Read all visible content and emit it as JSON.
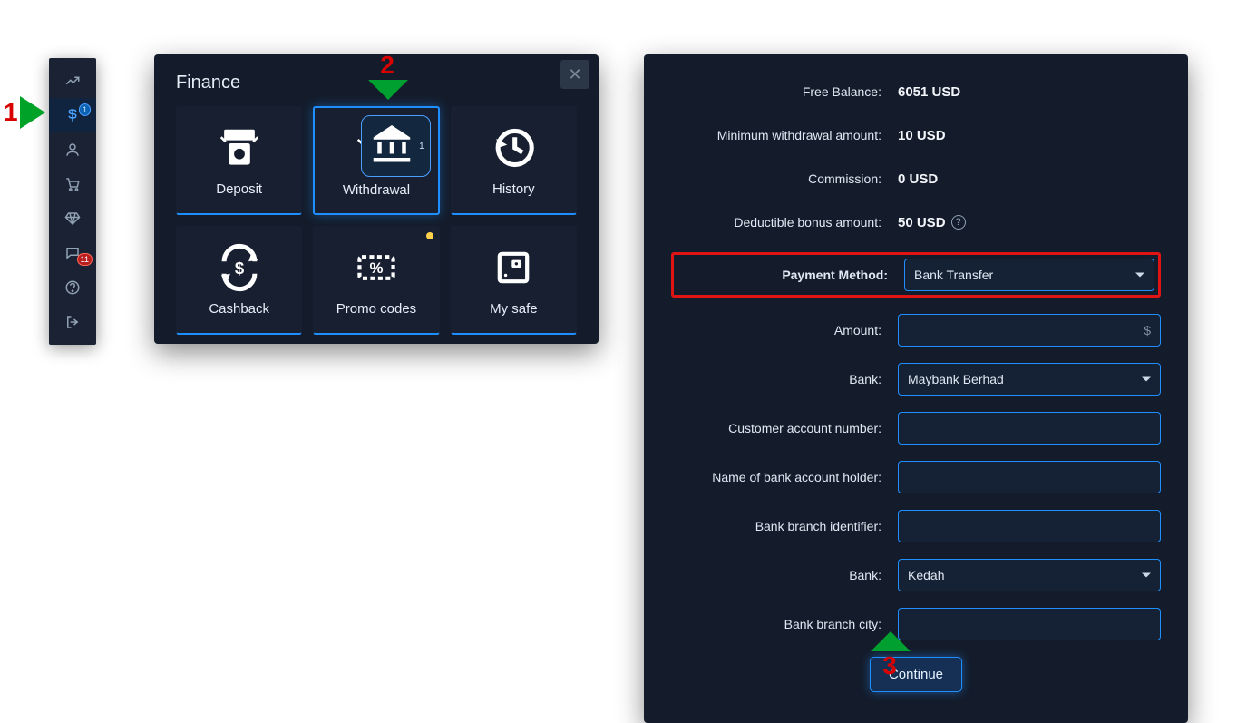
{
  "markers": {
    "one": "1",
    "two": "2",
    "three": "3"
  },
  "sidebar": {
    "items": [
      {
        "name": "chart-icon"
      },
      {
        "name": "finance-icon",
        "badge": "1",
        "active": true
      },
      {
        "name": "profile-icon"
      },
      {
        "name": "cart-icon"
      },
      {
        "name": "diamond-icon"
      },
      {
        "name": "chat-icon",
        "badge_red": "11"
      },
      {
        "name": "help-icon"
      },
      {
        "name": "logout-icon"
      }
    ]
  },
  "panel": {
    "title": "Finance",
    "tiles": [
      {
        "label": "Deposit"
      },
      {
        "label": "Withdrawal",
        "selected": true,
        "badge_icon": "bank-icon",
        "badge_text": "1"
      },
      {
        "label": "History"
      },
      {
        "label": "Cashback"
      },
      {
        "label": "Promo codes",
        "dot": true
      },
      {
        "label": "My safe"
      }
    ]
  },
  "form": {
    "rows": {
      "free_balance_label": "Free Balance:",
      "free_balance_value": "6051 USD",
      "min_withdraw_label": "Minimum withdrawal amount:",
      "min_withdraw_value": "10 USD",
      "commission_label": "Commission:",
      "commission_value": "0 USD",
      "deductible_label": "Deductible bonus amount:",
      "deductible_value": "50 USD",
      "payment_method_label": "Payment Method:",
      "payment_method_value": "Bank Transfer",
      "amount_label": "Amount:",
      "amount_suffix": "$",
      "bank_label": "Bank:",
      "bank_value": "Maybank Berhad",
      "account_number_label": "Customer account number:",
      "holder_label": "Name of bank account holder:",
      "branch_id_label": "Bank branch identifier:",
      "bank2_label": "Bank:",
      "bank2_value": "Kedah",
      "branch_city_label": "Bank branch city:"
    },
    "continue": "Continue",
    "help_glyph": "?"
  }
}
